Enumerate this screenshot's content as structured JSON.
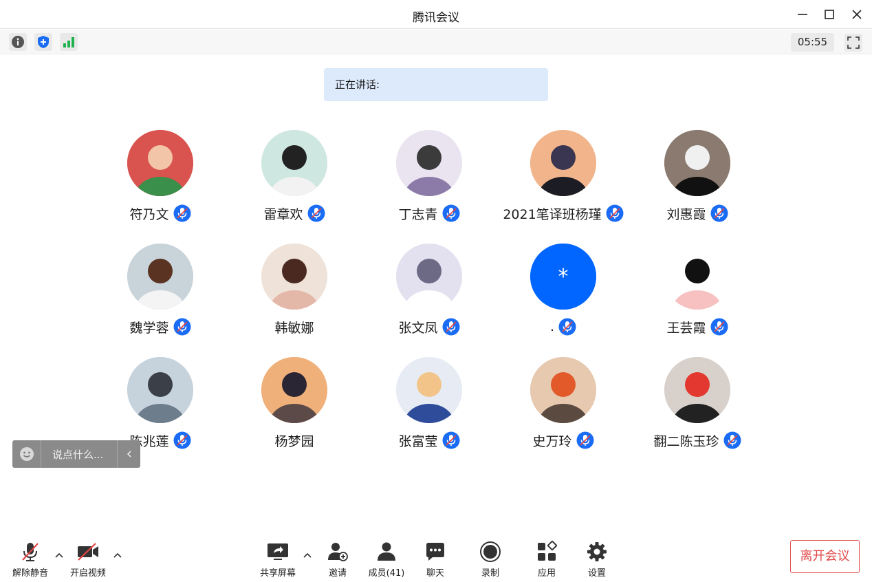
{
  "window": {
    "title": "腾讯会议"
  },
  "infobar": {
    "timer": "05:55"
  },
  "speaking": {
    "label": "正在讲话:"
  },
  "participants": [
    {
      "name": "符乃文",
      "muted": true
    },
    {
      "name": "雷章欢",
      "muted": true
    },
    {
      "name": "丁志青",
      "muted": true
    },
    {
      "name": "2021笔译班杨瑾",
      "muted": true
    },
    {
      "name": "刘惠霞",
      "muted": true
    },
    {
      "name": "魏学蓉",
      "muted": true
    },
    {
      "name": "韩敏娜",
      "muted": false
    },
    {
      "name": "张文凤",
      "muted": true
    },
    {
      "name": ".",
      "muted": true,
      "avatar_text": "*"
    },
    {
      "name": "王芸霞",
      "muted": true
    },
    {
      "name": "陈兆莲",
      "muted": true
    },
    {
      "name": "杨梦园",
      "muted": false
    },
    {
      "name": "张富莹",
      "muted": true
    },
    {
      "name": "史万玲",
      "muted": true
    },
    {
      "name": "翻二陈玉珍",
      "muted": true
    }
  ],
  "chat": {
    "placeholder": "说点什么..."
  },
  "toolbar": {
    "unmute": "解除静音",
    "video": "开启视频",
    "share": "共享屏幕",
    "invite": "邀请",
    "members": "成员(41)",
    "chat": "聊天",
    "record": "录制",
    "apps": "应用",
    "settings": "设置",
    "leave": "离开会议"
  },
  "colors": {
    "accent": "#0066ff",
    "danger": "#e04545",
    "banner": "#dceafc"
  }
}
